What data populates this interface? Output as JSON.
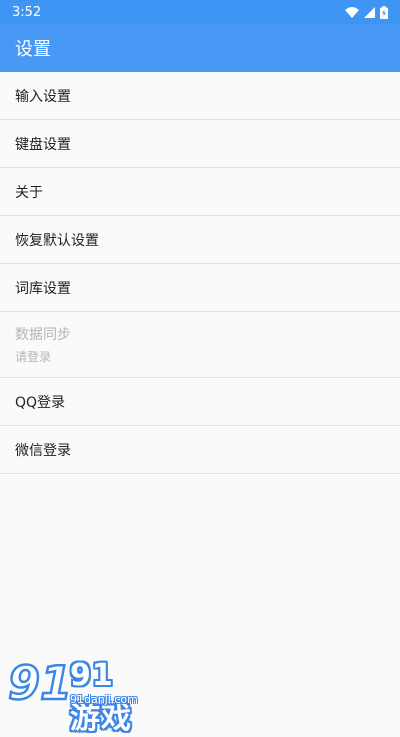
{
  "status_bar": {
    "time": "3:52",
    "icons": [
      "wifi-icon",
      "signal-icon",
      "battery-charging-icon"
    ]
  },
  "app_bar": {
    "title": "设置"
  },
  "settings": {
    "items": [
      {
        "label": "输入设置"
      },
      {
        "label": "键盘设置"
      },
      {
        "label": "关于"
      },
      {
        "label": "恢复默认设置"
      },
      {
        "label": "词库设置"
      },
      {
        "label": "数据同步",
        "subtitle": "请登录"
      },
      {
        "label": "QQ登录"
      },
      {
        "label": "微信登录"
      }
    ]
  },
  "watermark": {
    "logo_text": "91游戏",
    "url": "91danji.com"
  },
  "colors": {
    "status_bar": "#3f95f4",
    "app_bar": "#4799f5",
    "background": "#fafafa",
    "divider": "#e2e2e2",
    "disabled_text": "#b5b5b5"
  }
}
